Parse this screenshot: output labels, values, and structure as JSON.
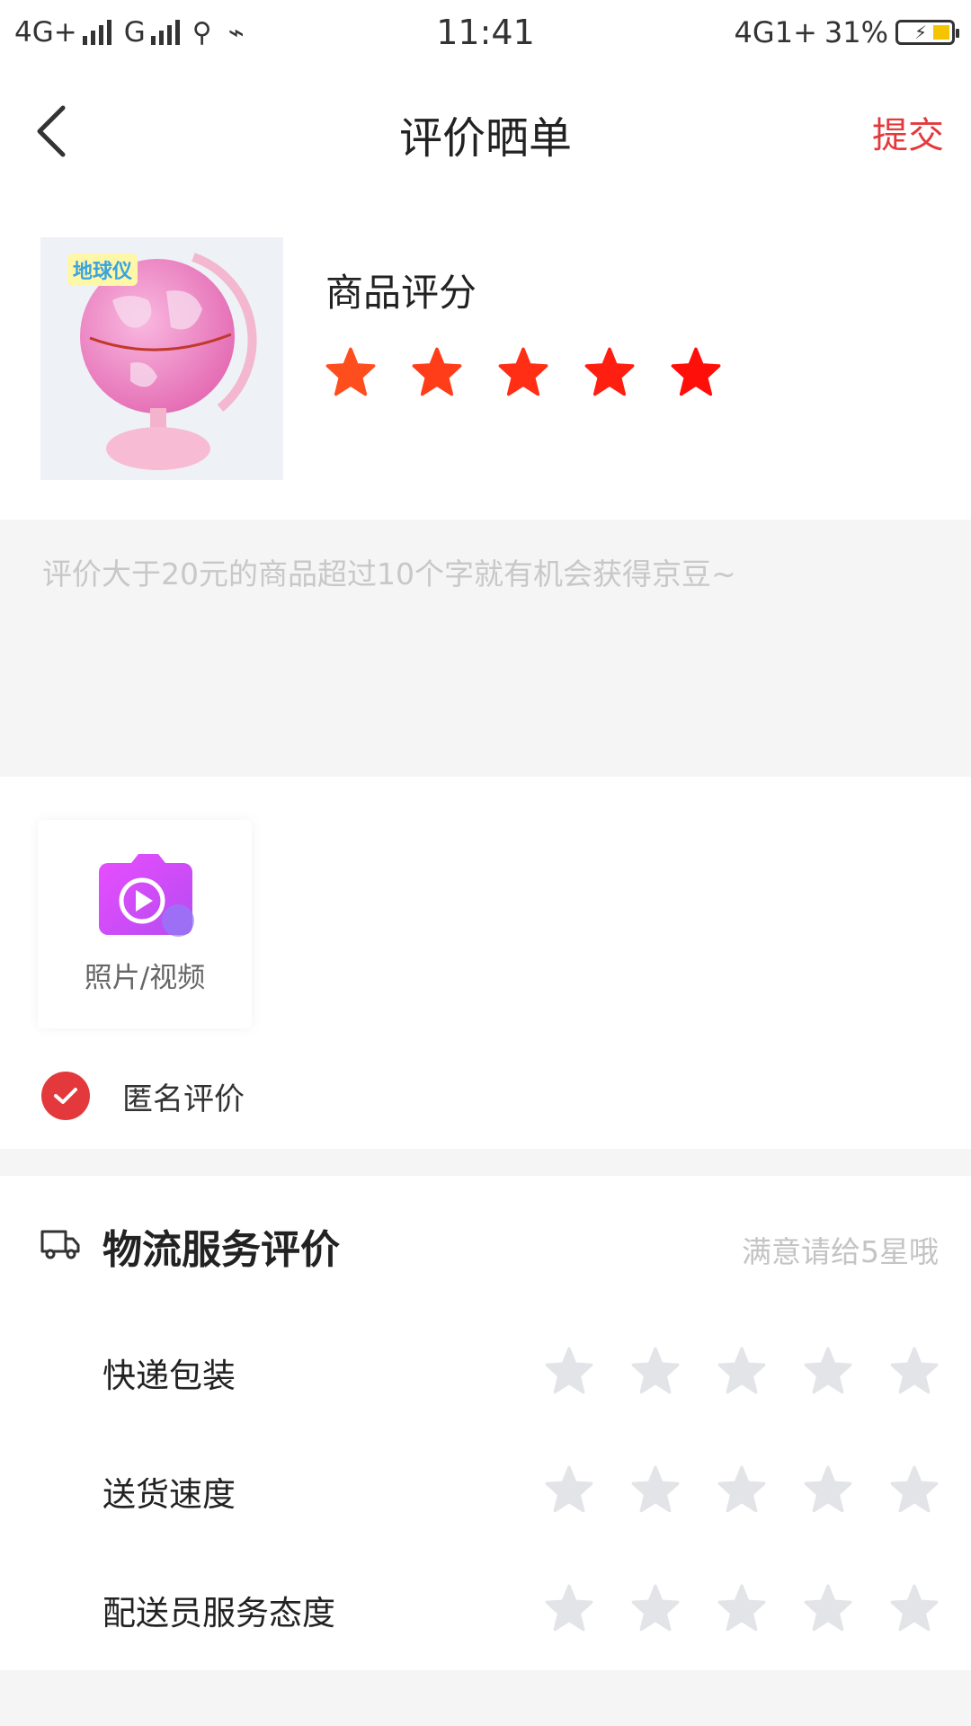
{
  "status_bar": {
    "left_network_1": "4G+",
    "left_network_2": "G",
    "time": "11:41",
    "right_network": "4G1+",
    "battery": "31%"
  },
  "nav": {
    "title": "评价晒单",
    "submit_label": "提交",
    "back_icon": "chevron-left-icon"
  },
  "product": {
    "thumb_logo": "地球仪",
    "rating_label": "商品评分",
    "rating": 5,
    "star_colors": [
      "#ff4e1e",
      "#ff3d18",
      "#ff2e14",
      "#ff1f10",
      "#ff0f0a"
    ]
  },
  "review": {
    "placeholder": "评价大于20元的商品超过10个字就有机会获得京豆~",
    "value": ""
  },
  "upload": {
    "label": "照片/视频",
    "icon": "camera-video-icon"
  },
  "anonymous": {
    "label": "匿名评价",
    "checked": true
  },
  "logistics": {
    "title": "物流服务评价",
    "hint": "满意请给5星哦",
    "icon": "truck-icon",
    "rows": [
      {
        "label": "快递包装",
        "rating": 0
      },
      {
        "label": "送货速度",
        "rating": 0
      },
      {
        "label": "配送员服务态度",
        "rating": 0
      }
    ]
  },
  "colors": {
    "accent": "#e4393c",
    "empty_star": "#e3e4e7",
    "divider": "#f5f5f5"
  }
}
